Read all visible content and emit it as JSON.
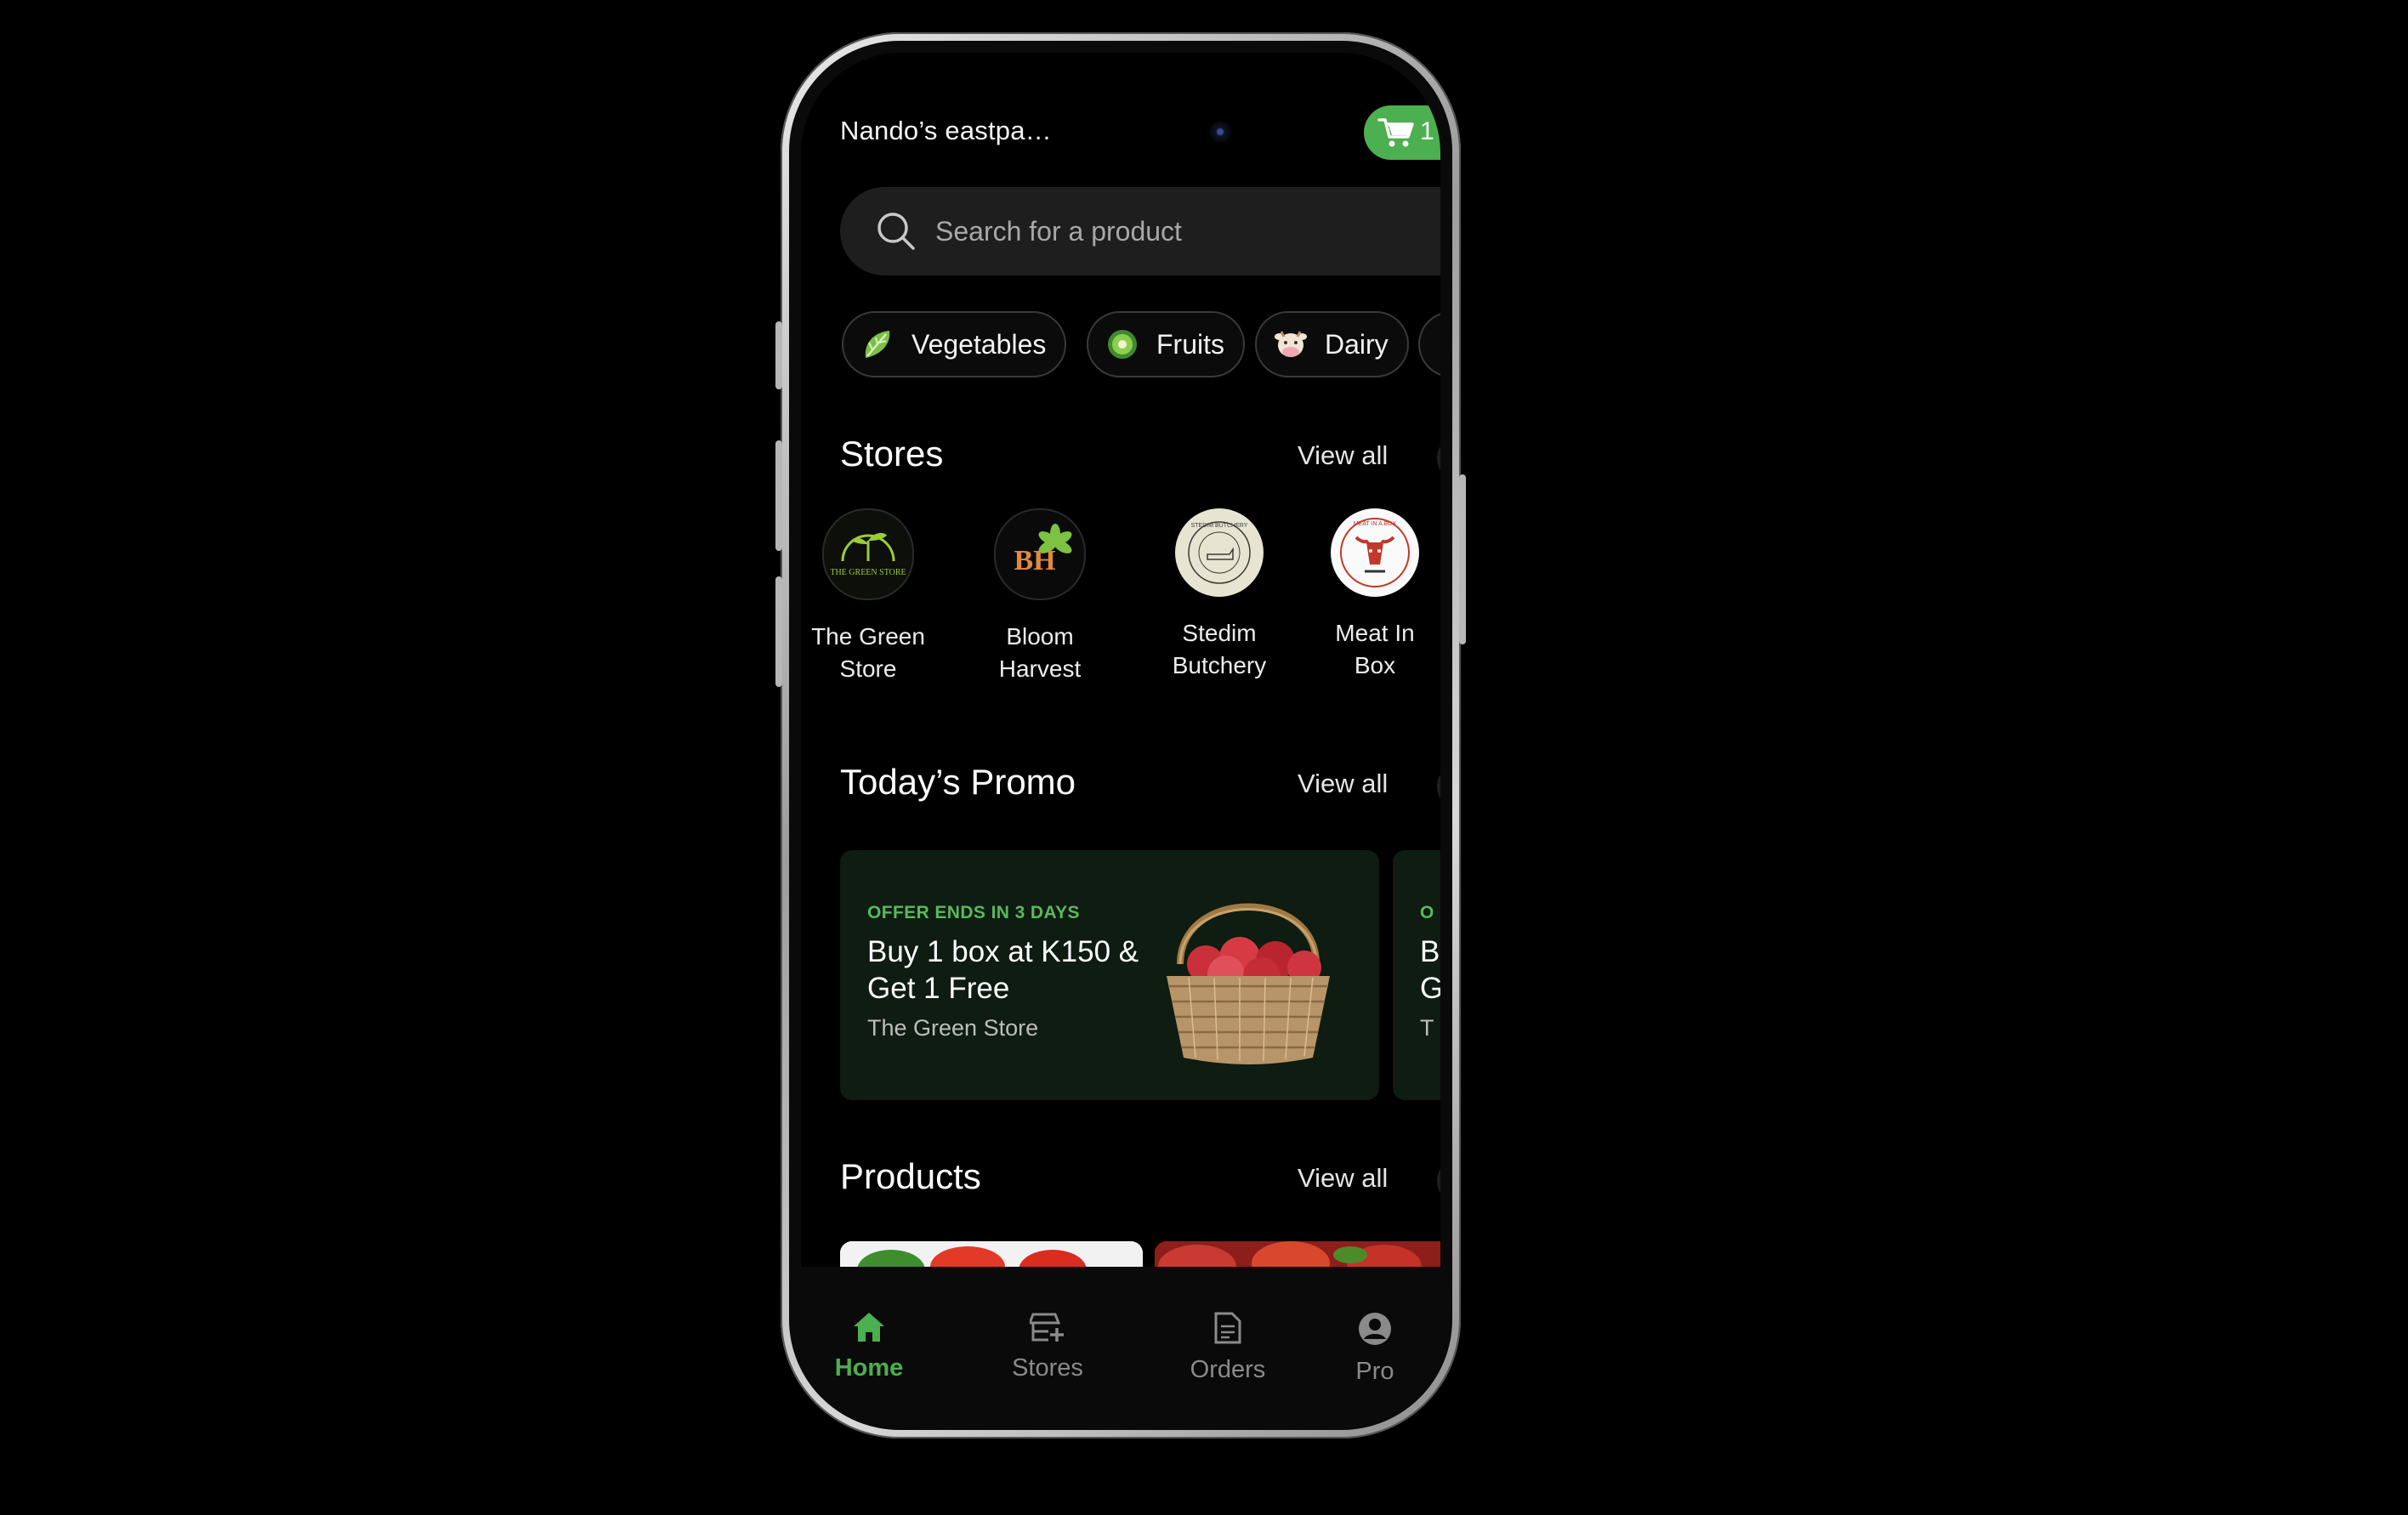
{
  "header": {
    "location": "Nando’s eastpa…",
    "cart_count": "1"
  },
  "search": {
    "placeholder": "Search for a product"
  },
  "categories": [
    {
      "label": "Vegetables",
      "icon": "lettuce-icon"
    },
    {
      "label": "Fruits",
      "icon": "kiwi-icon"
    },
    {
      "label": "Dairy",
      "icon": "cow-icon"
    }
  ],
  "stores_section": {
    "title": "Stores",
    "view_all": "View all",
    "items": [
      {
        "name_line1": "The Green",
        "name_line2": "Store",
        "logo_text": "THE GREEN STORE"
      },
      {
        "name_line1": "Bloom",
        "name_line2": "Harvest",
        "logo_text": "BH"
      },
      {
        "name_line1": "Stedim",
        "name_line2": "Butchery",
        "logo_text": "STEDIM BUTCHERY"
      },
      {
        "name_line1": "Meat In",
        "name_line2": "Box",
        "logo_text": "MEAT IN A BOX"
      }
    ]
  },
  "promo_section": {
    "title": "Today’s Promo",
    "view_all": "View all",
    "promos": [
      {
        "tag": "OFFER ENDS IN 3 DAYS",
        "title": "Buy 1 box at K150 & Get 1 Free",
        "store": "The Green Store"
      },
      {
        "tag": "O",
        "title_line1": "B",
        "title_line2": "G",
        "store": "T"
      }
    ]
  },
  "products_section": {
    "title": "Products",
    "view_all": "View all"
  },
  "nav": {
    "home": "Home",
    "stores": "Stores",
    "orders": "Orders",
    "profile": "Pro"
  },
  "colors": {
    "accent": "#4caf50",
    "background": "#000000",
    "card": "#0e1c12",
    "surface": "#1e1e1e"
  }
}
